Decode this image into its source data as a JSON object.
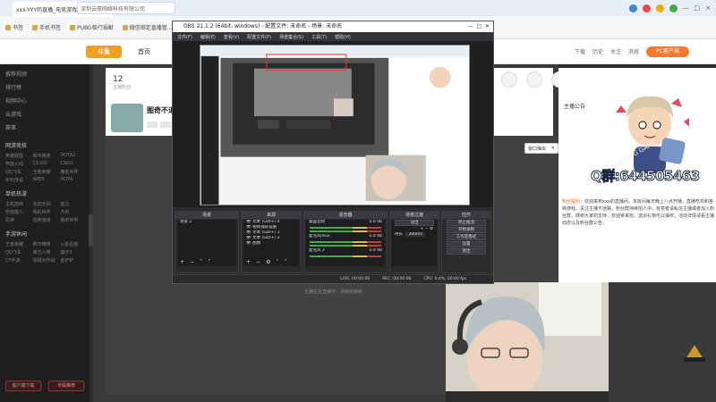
{
  "browser": {
    "tab_title": "xxx-YYY的直播_电竞游戏直播_斗鱼直",
    "address": "https://ww",
    "address_site_label": "深圳云豪网络科技有限公司",
    "bookmarks": [
      "书签",
      "手机书签",
      "PUBG极行捐献",
      "微信绑定直播管…"
    ],
    "window_buttons": [
      "—",
      "□",
      "×"
    ]
  },
  "site": {
    "logo": "斗鱼",
    "nav_home": "首页",
    "header_right_items": [
      "下载",
      "历史",
      "关注",
      "消息"
    ],
    "pc_pill": "PC客户端",
    "sidebar": {
      "top_items": [
        "推荐视频",
        "排行榜",
        "视频中心",
        "云游戏",
        "赛事"
      ],
      "section1_title": "网游竞技",
      "section1_items": [
        "英雄联盟",
        "和平精英",
        "DOTA2",
        "穿越火线",
        "CS:GO",
        "CSGO",
        "QQ飞车",
        "王者荣耀",
        "魔兽世界",
        "炉石传说",
        "APEX",
        "DOTA"
      ],
      "section2_title": "单机热游",
      "section2_items": [
        "主机游戏",
        "永劫无间",
        "鬼泣",
        "怪物猎人",
        "我的世界",
        "方舟",
        "原神",
        "恐怖游戏",
        "我的世界"
      ],
      "section3_title": "手游休闲",
      "section3_items": [
        "王者荣耀",
        "和平精英",
        "火影忍者",
        "QQ飞车",
        "第五人格",
        "崩坏3",
        "CF手游",
        "球球大作战",
        "金铲铲"
      ],
      "bottom_buttons": [
        "客户端下载",
        "专属推荐"
      ]
    },
    "room": {
      "stat_value": "12",
      "stat_label": "主播粉丝",
      "title": "图奇不退",
      "player_hint": "主播正在直播中，请稍候刷新"
    },
    "chat": {
      "header": "主播公告",
      "popout_label": "窗口弹出",
      "text_highlight": "粉丝福利",
      "text": "：欢迎来到xxx的直播间，本房间每天晚上八点开播，直播吃鸡和各种游戏。关注主播不迷路，粉丝群持续招人中，有意者请私信主播或者加入粉丝群。感谢大家的支持，欢迎常来玩。送出礼物可以抽奖，活动详情请看主播动态以及粉丝群公告。"
    }
  },
  "overlay": {
    "qq_text": "Q群:644505463",
    "avatar_sign": "CHANG GAME"
  },
  "obs": {
    "title": "OBS 21.1.2 (64bit, windows) - 配置文件: 未命名 - 场景: 未命名",
    "menu": [
      "文件(F)",
      "编辑(E)",
      "查看(V)",
      "配置文件(P)",
      "场景集合(S)",
      "工具(T)",
      "帮助(H)"
    ],
    "docks": {
      "scenes": {
        "title": "场景",
        "items": [
          "场景 2"
        ]
      },
      "sources": {
        "title": "来源",
        "items": [
          "文本 (GDI+) 4",
          "视频捕获设备",
          "文本 (GDI+) 3",
          "文本 (GDI+) 2",
          "图像"
        ]
      },
      "mixer": {
        "title": "混音器",
        "channels": [
          "桌面音频",
          "麦克风/Aux",
          "麦克风 2"
        ],
        "db": [
          "0.0 dB",
          "0.0 dB",
          "0.0 dB"
        ]
      },
      "transitions": {
        "title": "场景过渡",
        "mode": "淡出",
        "duration_label": "时长",
        "duration": "300ms"
      },
      "controls": {
        "title": "控件",
        "buttons": [
          "停止推流",
          "开始录制",
          "工作室模式",
          "设置",
          "退出"
        ]
      }
    },
    "status": [
      "LIVE: 00:00:00",
      "REC: 00:00:00",
      "CPU: 0.4%, 60.00 fps"
    ]
  }
}
